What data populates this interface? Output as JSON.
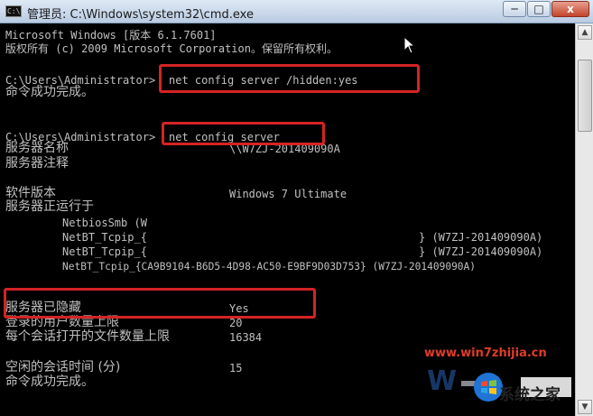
{
  "window": {
    "title": "管理员: C:\\Windows\\system32\\cmd.exe",
    "minimize": "─",
    "maximize": "□",
    "close": "x"
  },
  "console": {
    "banner_1": "Microsoft Windows [版本 6.1.7601]",
    "banner_2": "版权所有 (c) 2009 Microsoft Corporation。保留所有权利。",
    "prompt_1": "C:\\Users\\Administrator>",
    "cmd_1": "net config server /hidden:yes",
    "result_1": "命令成功完成。",
    "prompt_2": "C:\\Users\\Administrator>",
    "cmd_2": "net config server",
    "rows": {
      "server_name_label": "服务器名称",
      "server_name_value": "\\\\W7ZJ-201409090A",
      "server_comment_label": "服务器注释",
      "software_label": "软件版本",
      "software_value": "Windows 7 Ultimate",
      "running_on_label": "服务器正运行于",
      "transport_1": "NetbiosSmb (W",
      "transport_2_prefix": "NetBT_Tcpip_{",
      "transport_2_suffix": "} (W7ZJ-201409090A)",
      "transport_3_prefix": "NetBT_Tcpip_{",
      "transport_3_suffix": "} (W7ZJ-201409090A)",
      "transport_4": "NetBT_Tcpip_{CA9B9104-B6D5-4D98-AC50-E9BF9D03D753} (W7ZJ-201409090A)",
      "hidden_label": "服务器已隐藏",
      "hidden_value": "Yes",
      "max_users_label": "登录的用户数量上限",
      "max_users_value": "20",
      "max_files_label": "每个会话打开的文件数量上限",
      "max_files_value": "16384",
      "idle_label": "空闲的会话时间 (分)",
      "idle_value": "15",
      "result_2": "命令成功完成。"
    }
  },
  "watermark": {
    "url": "www.win7zhijia.cn",
    "brand": "系统之家"
  },
  "colors": {
    "console_bg": "#000000",
    "console_text": "#c0c0c0",
    "highlight": "#d42424"
  }
}
